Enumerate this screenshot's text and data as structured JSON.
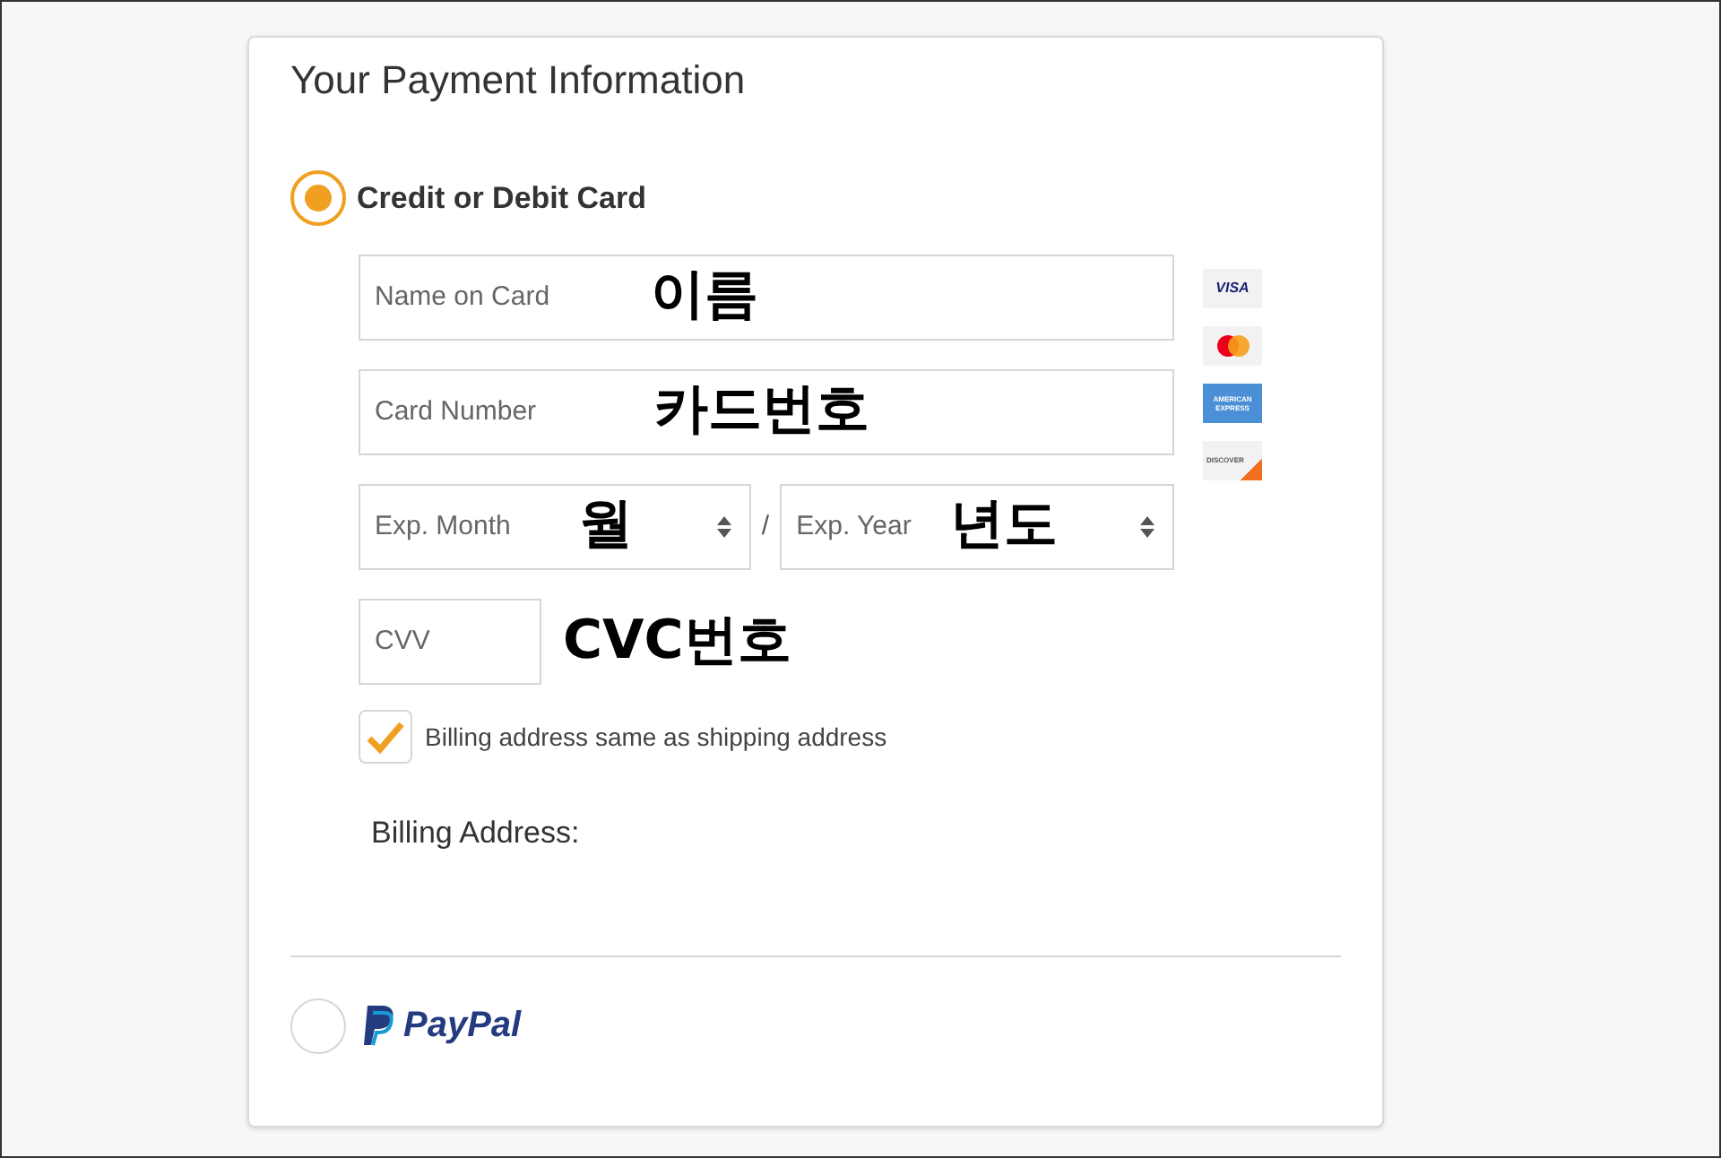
{
  "title": "Your Payment Information",
  "methods": [
    {
      "kind": "card",
      "label": "Credit or Debit Card",
      "selected": true
    },
    {
      "kind": "paypal",
      "label": "PayPal",
      "selected": false
    }
  ],
  "name_field": {
    "placeholder": "Name on Card",
    "annotation": "이름"
  },
  "number_field": {
    "placeholder": "Card Number",
    "annotation": "카드번호"
  },
  "month_select": {
    "placeholder": "Exp. Month",
    "annotation": "월"
  },
  "separator": "/",
  "year_select": {
    "placeholder": "Exp. Year",
    "annotation": "년도"
  },
  "cvv_field": {
    "placeholder": "CVV",
    "annotation": "CVC번호"
  },
  "card_logos": [
    {
      "kind": "visa",
      "label": "VISA"
    },
    {
      "kind": "mastercard"
    },
    {
      "kind": "amex",
      "label": "AMERICAN EXPRESS"
    },
    {
      "kind": "discover",
      "label": "DISCOVER"
    }
  ],
  "same_address": {
    "label": "Billing address same as shipping address",
    "checked": true
  },
  "billing_label": "Billing Address:"
}
